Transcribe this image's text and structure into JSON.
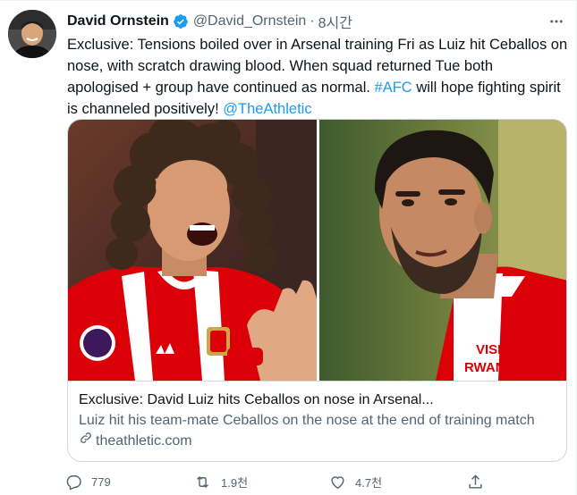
{
  "tweet": {
    "author_name": "David Ornstein",
    "author_handle": "@David_Ornstein",
    "separator": "·",
    "time_ago": "8시간",
    "text_lines": [
      "Exclusive: Tensions boiled over in Arsenal training Fri as Luiz hit Ceballos on",
      "nose, with scratch drawing blood. When squad returned Tue both",
      "apologised + group have continued as normal.",
      "is channeled positively!"
    ],
    "hashtag": "#AFC",
    "after_hashtag": " will hope fighting spirit",
    "mention": "@TheAthletic"
  },
  "card": {
    "title": "Exclusive: David Luiz hits Ceballos on nose in Arsenal...",
    "description": "Luiz hit his team-mate Ceballos on the nose at the end of training match",
    "domain": "theathletic.com",
    "left_shirt_sponsor": "",
    "right_shirt_text": "VISIT\nRWANDA"
  },
  "actions": {
    "replies": "779",
    "retweets": "1.9천",
    "likes": "4.7천"
  },
  "colors": {
    "link": "#1d9bf0",
    "verified": "#1d9bf0",
    "secondary_text": "#536471",
    "arsenal_red": "#db0007"
  },
  "icons": [
    "verified-badge-icon",
    "more-icon",
    "link-icon",
    "reply-icon",
    "retweet-icon",
    "like-icon",
    "share-icon"
  ]
}
